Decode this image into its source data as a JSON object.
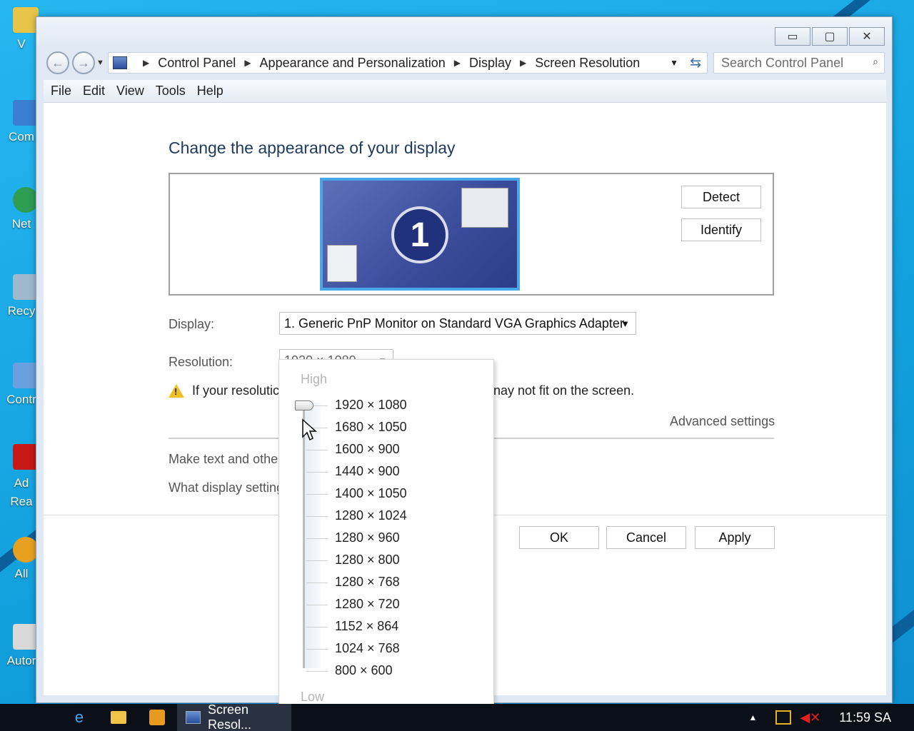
{
  "desktop": {
    "icons": [
      {
        "label": "V",
        "color": "#e8c44a"
      },
      {
        "label": "Com",
        "color": "#3a7fd0"
      },
      {
        "label": "Net",
        "color": "#2d9d52"
      },
      {
        "label": "Recy",
        "color": "#a0b8cc"
      },
      {
        "label": "Contr",
        "color": "#6a9fe0"
      },
      {
        "label": "Ad\nRea",
        "color": "#c81818"
      },
      {
        "label": "All",
        "color": "#e8a020"
      },
      {
        "label": "Autor",
        "color": "#d9d9d9"
      }
    ]
  },
  "window": {
    "caption": {
      "minimize": "▭",
      "maximize": "▢",
      "close": "✕"
    },
    "address": {
      "crumbs": [
        "Control Panel",
        "Appearance and Personalization",
        "Display",
        "Screen Resolution"
      ]
    },
    "search": {
      "placeholder": "Search Control Panel",
      "icon": "search-icon"
    },
    "menu": [
      "File",
      "Edit",
      "View",
      "Tools",
      "Help"
    ]
  },
  "main": {
    "heading": "Change the appearance of your display",
    "monitor_number": "1",
    "detect_label": "Detect",
    "identify_label": "Identify",
    "display_label": "Display:",
    "display_value": "1. Generic PnP Monitor on Standard VGA Graphics Adapter",
    "resolution_label": "Resolution:",
    "resolution_value": "1920 × 1080",
    "warning_text_left": "If your resolutic",
    "warning_text_right": "nay not fit on the screen.",
    "advanced_settings": "Advanced settings",
    "make_text_link": "Make text and othei",
    "what_display_link": "What display setting",
    "ok_label": "OK",
    "cancel_label": "Cancel",
    "apply_label": "Apply"
  },
  "resolution_dropdown": {
    "high_label": "High",
    "low_label": "Low",
    "selected_index": 0,
    "options": [
      "1920 × 1080",
      "1680 × 1050",
      "1600 × 900",
      "1440 × 900",
      "1400 × 1050",
      "1280 × 1024",
      "1280 × 960",
      "1280 × 800",
      "1280 × 768",
      "1280 × 720",
      "1152 × 864",
      "1024 × 768",
      "800 × 600"
    ]
  },
  "taskbar": {
    "app_label": "Screen Resol...",
    "clock": "11:59 SA"
  }
}
